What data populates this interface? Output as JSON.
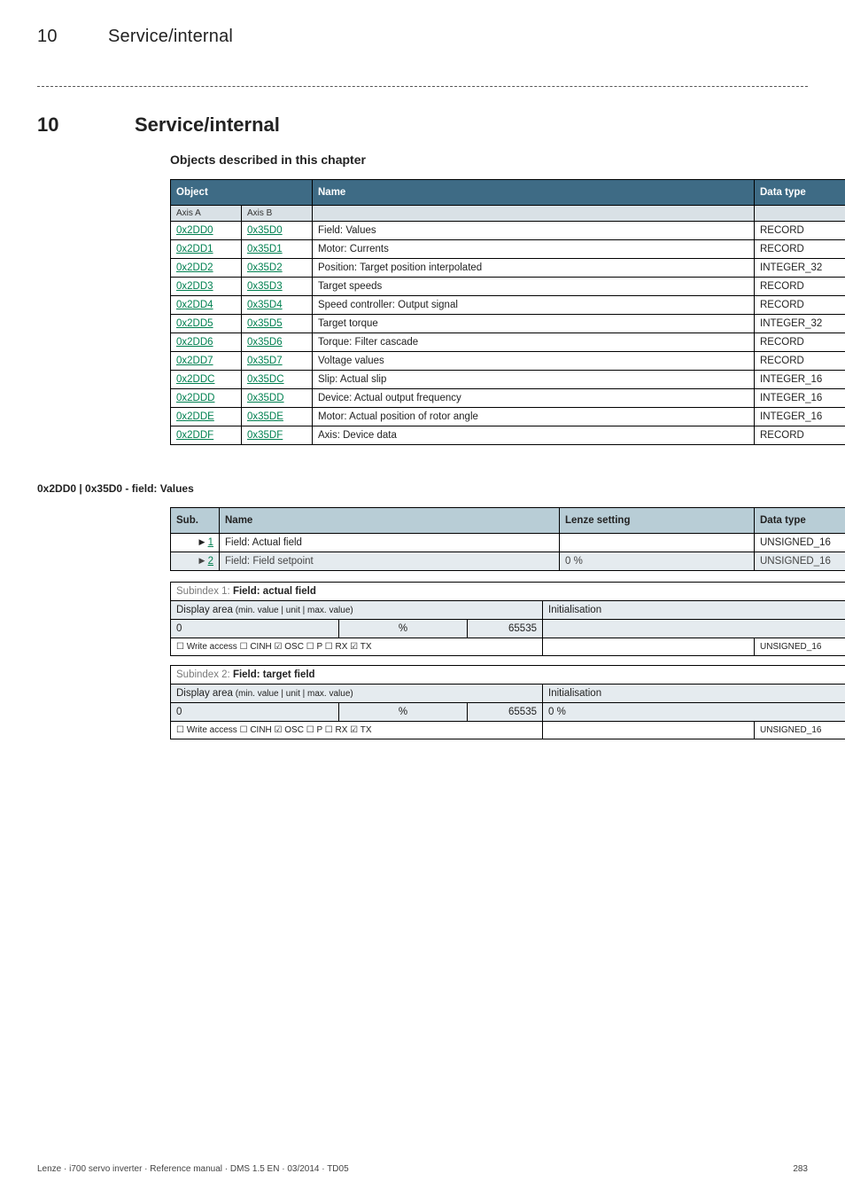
{
  "running_head": {
    "num": "10",
    "title": "Service/internal"
  },
  "separator": "–––––––––––––––––––––––––––––––––––––––––––––––––––––––––––––––",
  "section": {
    "num": "10",
    "title": "Service/internal"
  },
  "sub_heading": "Objects described in this chapter",
  "obj_table": {
    "headers": {
      "object": "Object",
      "name": "Name",
      "datatype": "Data type"
    },
    "axis": {
      "a": "Axis A",
      "b": "Axis B"
    },
    "rows": [
      {
        "a": "0x2DD0",
        "b": "0x35D0",
        "name": "Field: Values",
        "dt": "RECORD"
      },
      {
        "a": "0x2DD1",
        "b": "0x35D1",
        "name": "Motor: Currents",
        "dt": "RECORD"
      },
      {
        "a": "0x2DD2",
        "b": "0x35D2",
        "name": "Position: Target position interpolated",
        "dt": "INTEGER_32"
      },
      {
        "a": "0x2DD3",
        "b": "0x35D3",
        "name": "Target speeds",
        "dt": "RECORD"
      },
      {
        "a": "0x2DD4",
        "b": "0x35D4",
        "name": "Speed controller: Output signal",
        "dt": "RECORD"
      },
      {
        "a": "0x2DD5",
        "b": "0x35D5",
        "name": "Target torque",
        "dt": "INTEGER_32"
      },
      {
        "a": "0x2DD6",
        "b": "0x35D6",
        "name": "Torque: Filter cascade",
        "dt": "RECORD"
      },
      {
        "a": "0x2DD7",
        "b": "0x35D7",
        "name": "Voltage values",
        "dt": "RECORD"
      },
      {
        "a": "0x2DDC",
        "b": "0x35DC",
        "name": "Slip: Actual slip",
        "dt": "INTEGER_16"
      },
      {
        "a": "0x2DDD",
        "b": "0x35DD",
        "name": "Device: Actual output frequency",
        "dt": "INTEGER_16"
      },
      {
        "a": "0x2DDE",
        "b": "0x35DE",
        "name": "Motor: Actual position of rotor angle",
        "dt": "INTEGER_16"
      },
      {
        "a": "0x2DDF",
        "b": "0x35DF",
        "name": "Axis: Device data",
        "dt": "RECORD"
      }
    ]
  },
  "anchor_title": "0x2DD0 | 0x35D0 - field: Values",
  "sub_table": {
    "headers": {
      "sub": "Sub.",
      "name": "Name",
      "lenze": "Lenze setting",
      "dt": "Data type"
    },
    "rows": [
      {
        "idx": "1",
        "name": "Field: Actual field",
        "lenze": "",
        "dt": "UNSIGNED_16"
      },
      {
        "idx": "2",
        "name": "Field: Field setpoint",
        "lenze": "0 %",
        "dt": "UNSIGNED_16"
      }
    ]
  },
  "detail1": {
    "title_prefix": "Subindex 1: ",
    "title_bold": "Field: actual field",
    "disp_label": "Display area",
    "disp_hint": " (min. value | unit | max. value)",
    "init_label": "Initialisation",
    "min": "0",
    "unit": "%",
    "max": "65535",
    "init": "",
    "flags": "☐ Write access   ☐ CINH   ☑ OSC   ☐ P   ☐ RX   ☑ TX",
    "dt": "UNSIGNED_16"
  },
  "detail2": {
    "title_prefix": "Subindex 2: ",
    "title_bold": "Field: target field",
    "disp_label": "Display area",
    "disp_hint": " (min. value | unit | max. value)",
    "init_label": "Initialisation",
    "min": "0",
    "unit": "%",
    "max": "65535",
    "init": "0 %",
    "flags": "☐ Write access   ☐ CINH   ☑ OSC   ☐ P   ☐ RX   ☑ TX",
    "dt": "UNSIGNED_16"
  },
  "footer": {
    "left": "Lenze · i700 servo inverter · Reference manual · DMS 1.5 EN · 03/2014 · TD05",
    "right": "283"
  }
}
